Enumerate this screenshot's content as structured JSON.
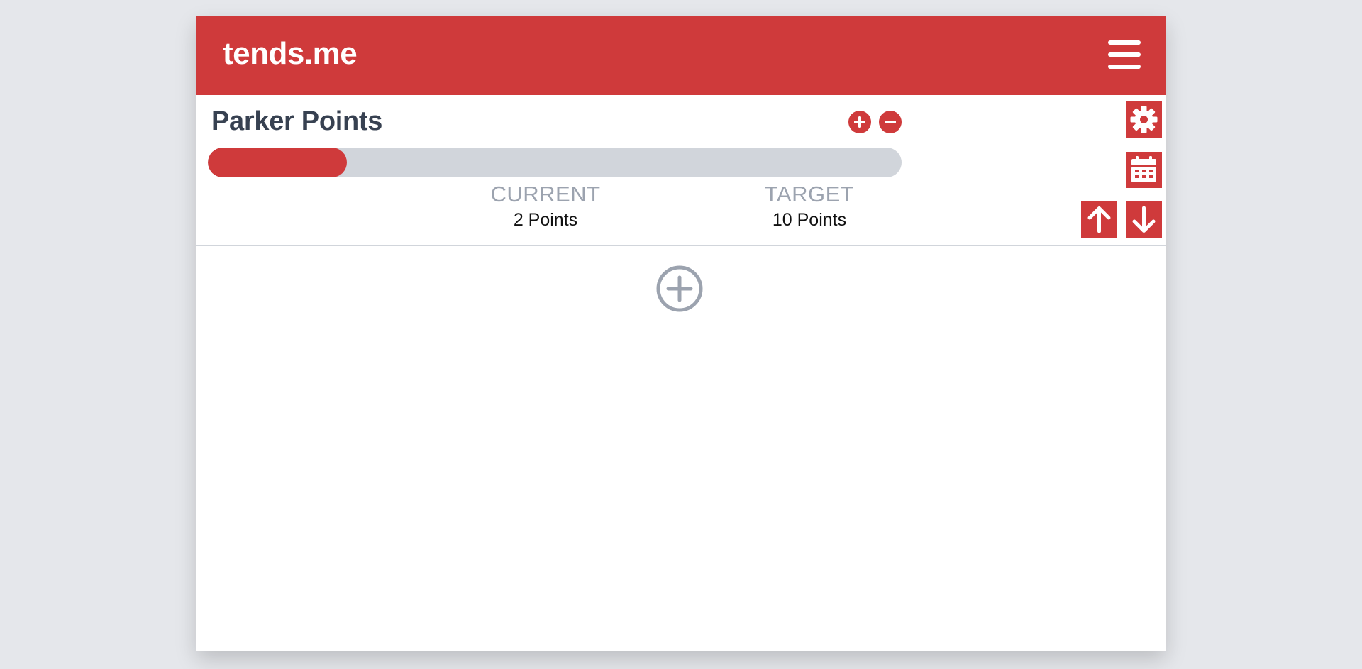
{
  "header": {
    "brand": "tends.me",
    "menu_icon": "hamburger-menu-icon",
    "accent_color": "#cf3a3b"
  },
  "goal": {
    "title": "Parker Points",
    "progress_fraction": 0.2,
    "current": {
      "label": "CURRENT",
      "value": "2 Points"
    },
    "target": {
      "label": "TARGET",
      "value": "10 Points"
    },
    "controls": {
      "increment_icon": "plus-circle-icon",
      "decrement_icon": "minus-circle-icon",
      "settings_icon": "gear-icon",
      "calendar_icon": "calendar-icon",
      "move_up_icon": "arrow-up-icon",
      "move_down_icon": "arrow-down-icon"
    }
  },
  "add_goal": {
    "icon": "plus-circle-outline-icon"
  }
}
